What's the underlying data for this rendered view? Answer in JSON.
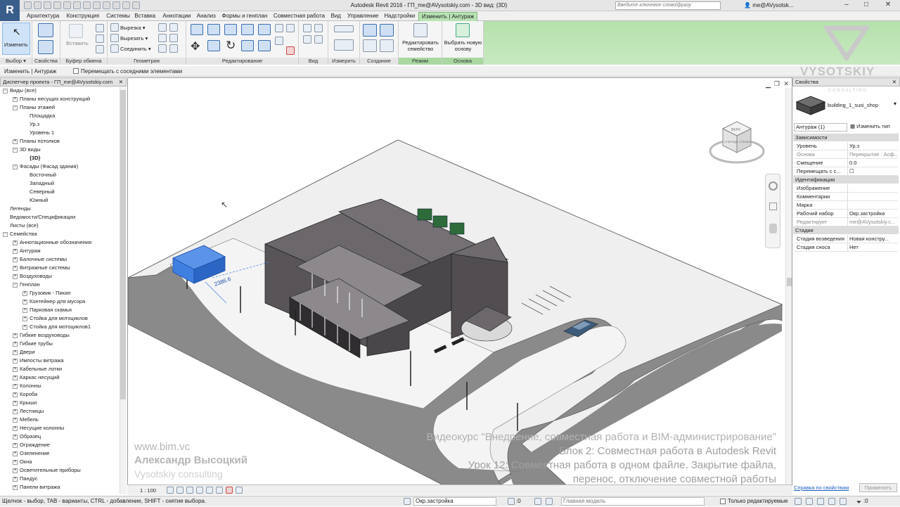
{
  "app": {
    "logo": "R",
    "title": "Autodesk Revit 2016 -    ГП_me@AVysotskiy.com - 3D вид: {3D}",
    "search_placeholder": "Введите ключевое слово/фразу",
    "user": "me@AVysotsk...",
    "window_controls": [
      "–",
      "□",
      "✕"
    ]
  },
  "tabs": [
    "Архитектура",
    "Конструкция",
    "Системы",
    "Вставка",
    "Аннотации",
    "Анализ",
    "Формы и генплан",
    "Совместная работа",
    "Вид",
    "Управление",
    "Надстройки",
    "Изменить | Антураж"
  ],
  "ribbon": {
    "modify": {
      "label": "Изменить",
      "panel": "Выбор ▾"
    },
    "properties": {
      "panel": "Свойства"
    },
    "clipboard": {
      "paste": "Вставить",
      "panel": "Буфер обмена"
    },
    "geometry": {
      "cut": "Вырезать ▾",
      "join": "Соединить ▾",
      "notch": "Вырезка ▾",
      "panel": "Геометрия"
    },
    "editing": {
      "panel": "Редактирование"
    },
    "view": {
      "panel": "Вид"
    },
    "measure": {
      "panel": "Измерить"
    },
    "create": {
      "panel": "Создание"
    },
    "mode": {
      "edit_family": "Редактировать семейство",
      "panel": "Режим"
    },
    "host": {
      "pick_host": "Выбрать новую основу",
      "panel": "Основа"
    }
  },
  "options_bar": {
    "context": "Изменить | Антураж",
    "move_with_neighbors": "Перемещать с соседними элементами"
  },
  "project_browser": {
    "title": "Диспетчер проекта - ГП_me@AVysotskiy.com",
    "rows": [
      {
        "t": "Виды (все)",
        "lvl": 0,
        "tg": "−"
      },
      {
        "t": "Планы несущих конструкций",
        "lvl": 1,
        "tg": "+"
      },
      {
        "t": "Планы этажей",
        "lvl": 1,
        "tg": "−"
      },
      {
        "t": "Площадка",
        "lvl": 2,
        "tg": ""
      },
      {
        "t": "Ур.з",
        "lvl": 2,
        "tg": ""
      },
      {
        "t": "Уровень 1",
        "lvl": 2,
        "tg": ""
      },
      {
        "t": "Планы потолков",
        "lvl": 1,
        "tg": "+"
      },
      {
        "t": "3D виды",
        "lvl": 1,
        "tg": "−"
      },
      {
        "t": "{3D}",
        "lvl": 2,
        "tg": "",
        "b": true
      },
      {
        "t": "Фасады (Фасад здания)",
        "lvl": 1,
        "tg": "−"
      },
      {
        "t": "Восточный",
        "lvl": 2,
        "tg": ""
      },
      {
        "t": "Западный",
        "lvl": 2,
        "tg": ""
      },
      {
        "t": "Северный",
        "lvl": 2,
        "tg": ""
      },
      {
        "t": "Южный",
        "lvl": 2,
        "tg": ""
      },
      {
        "t": "Легенды",
        "lvl": 0,
        "tg": ""
      },
      {
        "t": "Ведомости/Спецификации",
        "lvl": 0,
        "tg": ""
      },
      {
        "t": "Листы (все)",
        "lvl": 0,
        "tg": ""
      },
      {
        "t": "Семейства",
        "lvl": 0,
        "tg": "−"
      },
      {
        "t": "Аннотационные обозначения",
        "lvl": 1,
        "tg": "+"
      },
      {
        "t": "Антураж",
        "lvl": 1,
        "tg": "+"
      },
      {
        "t": "Балочные системы",
        "lvl": 1,
        "tg": "+"
      },
      {
        "t": "Витражные системы",
        "lvl": 1,
        "tg": "+"
      },
      {
        "t": "Воздуховоды",
        "lvl": 1,
        "tg": "+"
      },
      {
        "t": "Генплан",
        "lvl": 1,
        "tg": "−"
      },
      {
        "t": "Грузовик - Пикап",
        "lvl": 2,
        "tg": "+"
      },
      {
        "t": "Контейнер для мусора",
        "lvl": 2,
        "tg": "+"
      },
      {
        "t": "Парковая скамья",
        "lvl": 2,
        "tg": "+"
      },
      {
        "t": "Стойка для мотоциклов",
        "lvl": 2,
        "tg": "+"
      },
      {
        "t": "Стойка для мотоциклов1",
        "lvl": 2,
        "tg": "+"
      },
      {
        "t": "Гибкие воздуховоды",
        "lvl": 1,
        "tg": "+"
      },
      {
        "t": "Гибкие трубы",
        "lvl": 1,
        "tg": "+"
      },
      {
        "t": "Двери",
        "lvl": 1,
        "tg": "+"
      },
      {
        "t": "Импосты витража",
        "lvl": 1,
        "tg": "+"
      },
      {
        "t": "Кабельные лотки",
        "lvl": 1,
        "tg": "+"
      },
      {
        "t": "Каркас несущий",
        "lvl": 1,
        "tg": "+"
      },
      {
        "t": "Колонны",
        "lvl": 1,
        "tg": "+"
      },
      {
        "t": "Короба",
        "lvl": 1,
        "tg": "+"
      },
      {
        "t": "Крыши",
        "lvl": 1,
        "tg": "+"
      },
      {
        "t": "Лестницы",
        "lvl": 1,
        "tg": "+"
      },
      {
        "t": "Мебель",
        "lvl": 1,
        "tg": "+"
      },
      {
        "t": "Несущие колонны",
        "lvl": 1,
        "tg": "+"
      },
      {
        "t": "Образец",
        "lvl": 1,
        "tg": "+"
      },
      {
        "t": "Ограждение",
        "lvl": 1,
        "tg": "+"
      },
      {
        "t": "Озеленение",
        "lvl": 1,
        "tg": "+"
      },
      {
        "t": "Окна",
        "lvl": 1,
        "tg": "+"
      },
      {
        "t": "Осветительные приборы",
        "lvl": 1,
        "tg": "+"
      },
      {
        "t": "Пандус",
        "lvl": 1,
        "tg": "+"
      },
      {
        "t": "Панели витража",
        "lvl": 1,
        "tg": "+"
      }
    ]
  },
  "viewport": {
    "dimension": "2386.6",
    "viewcube": {
      "top": "ВЕРХ",
      "front": "СПЕРЕДИ",
      "right": "СПРАВА"
    },
    "overlay_left": {
      "line1": "www.bim.vc",
      "line2": "Александр Высоцкий",
      "line3": "Vysotskiy consulting"
    },
    "overlay_right": {
      "line1": "Видеокурс \"Внедрение, совместная работа и BIM-администрирование\"",
      "line2": "Блок 2: Совместная работа в Autodesk Revit",
      "line3": "Урок 12: Совместная работа в одном файле. Закрытие файла,",
      "line4": "перенос, отключение совместной работы"
    },
    "scale": "1 : 100"
  },
  "properties": {
    "title": "Свойства",
    "type_name": "building_1_susi_shop",
    "instance_filter": "Антураж (1)",
    "edit_type": "Изменить тип",
    "groups": [
      {
        "name": "Зависимости",
        "rows": [
          [
            "Уровень",
            "Ур.з",
            false
          ],
          [
            "Основа",
            "Перекрытие : Асф...",
            true
          ],
          [
            "Смещение",
            "0.0",
            false
          ],
          [
            "Перемещать с с...",
            "☐",
            false
          ]
        ]
      },
      {
        "name": "Идентификация",
        "rows": [
          [
            "Изображение",
            "",
            false
          ],
          [
            "Комментарии",
            "",
            false
          ],
          [
            "Марка",
            "",
            false
          ],
          [
            "Рабочий набор",
            "Окр.застройка",
            false
          ],
          [
            "Редактирует",
            "me@AVysotskiy.c...",
            true
          ]
        ]
      },
      {
        "name": "Стадии",
        "rows": [
          [
            "Стадия возведения",
            "Новая констру...",
            false
          ],
          [
            "Стадия сноса",
            "Нет",
            false
          ]
        ]
      }
    ],
    "help_link": "Справка по свойствам",
    "apply": "Применить"
  },
  "watermark": {
    "brand": "VYSOTSKIY",
    "sub": "C O N S U L T I N G"
  },
  "status": {
    "hint": "Щелчок - выбор, TAB - варианты, CTRL - добавление, SHIFT - снятие выбора.",
    "workset": "Окр.застройка",
    "selection_count": ":0",
    "design_option": "Главная модель",
    "editable_only": "Только редактируемые",
    "filter": ":0"
  },
  "colors": {
    "ribbon_contextual": "#b9e3b4",
    "selection_blue": "#3f7fe0",
    "building": "#5d5a5e"
  }
}
